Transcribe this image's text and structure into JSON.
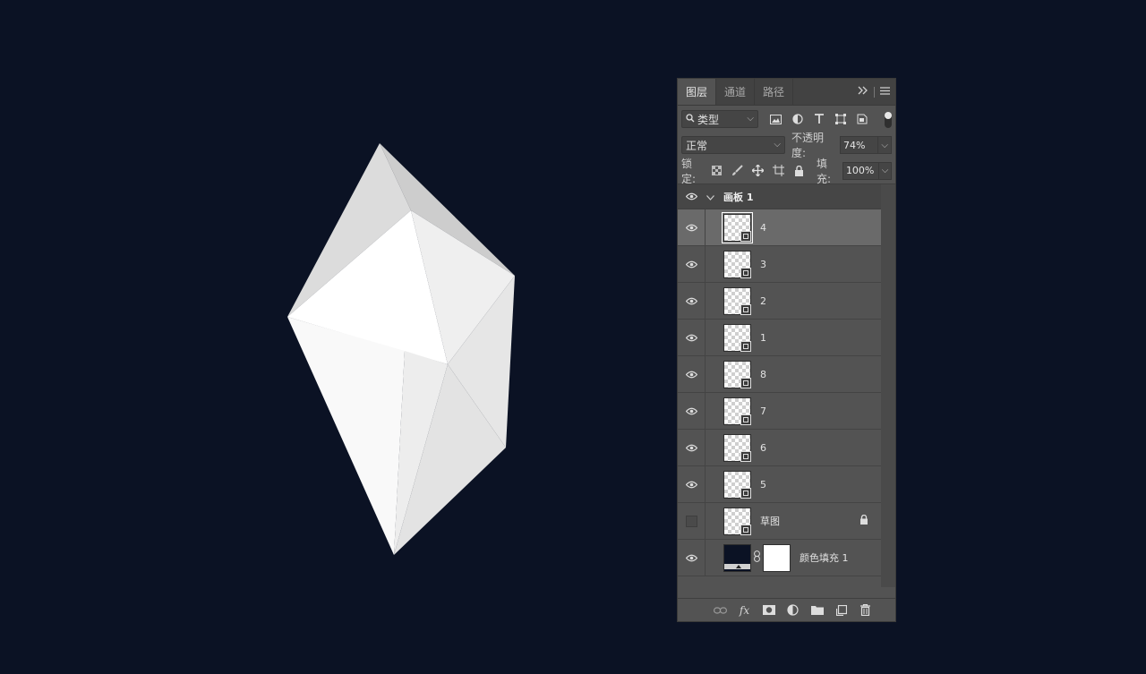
{
  "panel": {
    "tabs": [
      {
        "label": "图层",
        "active": true
      },
      {
        "label": "通道",
        "active": false
      },
      {
        "label": "路径",
        "active": false
      }
    ],
    "filter": {
      "kind_label": "类型"
    },
    "blend": {
      "mode": "正常",
      "opacity_label": "不透明度:",
      "opacity_value": "74%"
    },
    "lock": {
      "label": "锁定:",
      "fill_label": "填充:",
      "fill_value": "100%"
    },
    "group": {
      "name": "画板 1"
    },
    "layers": [
      {
        "name": "4",
        "visible": true,
        "selected": true
      },
      {
        "name": "3",
        "visible": true
      },
      {
        "name": "2",
        "visible": true
      },
      {
        "name": "1",
        "visible": true
      },
      {
        "name": "8",
        "visible": true
      },
      {
        "name": "7",
        "visible": true
      },
      {
        "name": "6",
        "visible": true
      },
      {
        "name": "5",
        "visible": true
      },
      {
        "name": "草图",
        "visible": false,
        "locked": true
      },
      {
        "name": "颜色填充 1",
        "visible": true,
        "fill": true
      }
    ],
    "fx_label": "fx"
  },
  "colors": {
    "canvas_bg": "#0b1224",
    "panel_bg": "#535353",
    "selected_row": "#6a6a6a"
  }
}
